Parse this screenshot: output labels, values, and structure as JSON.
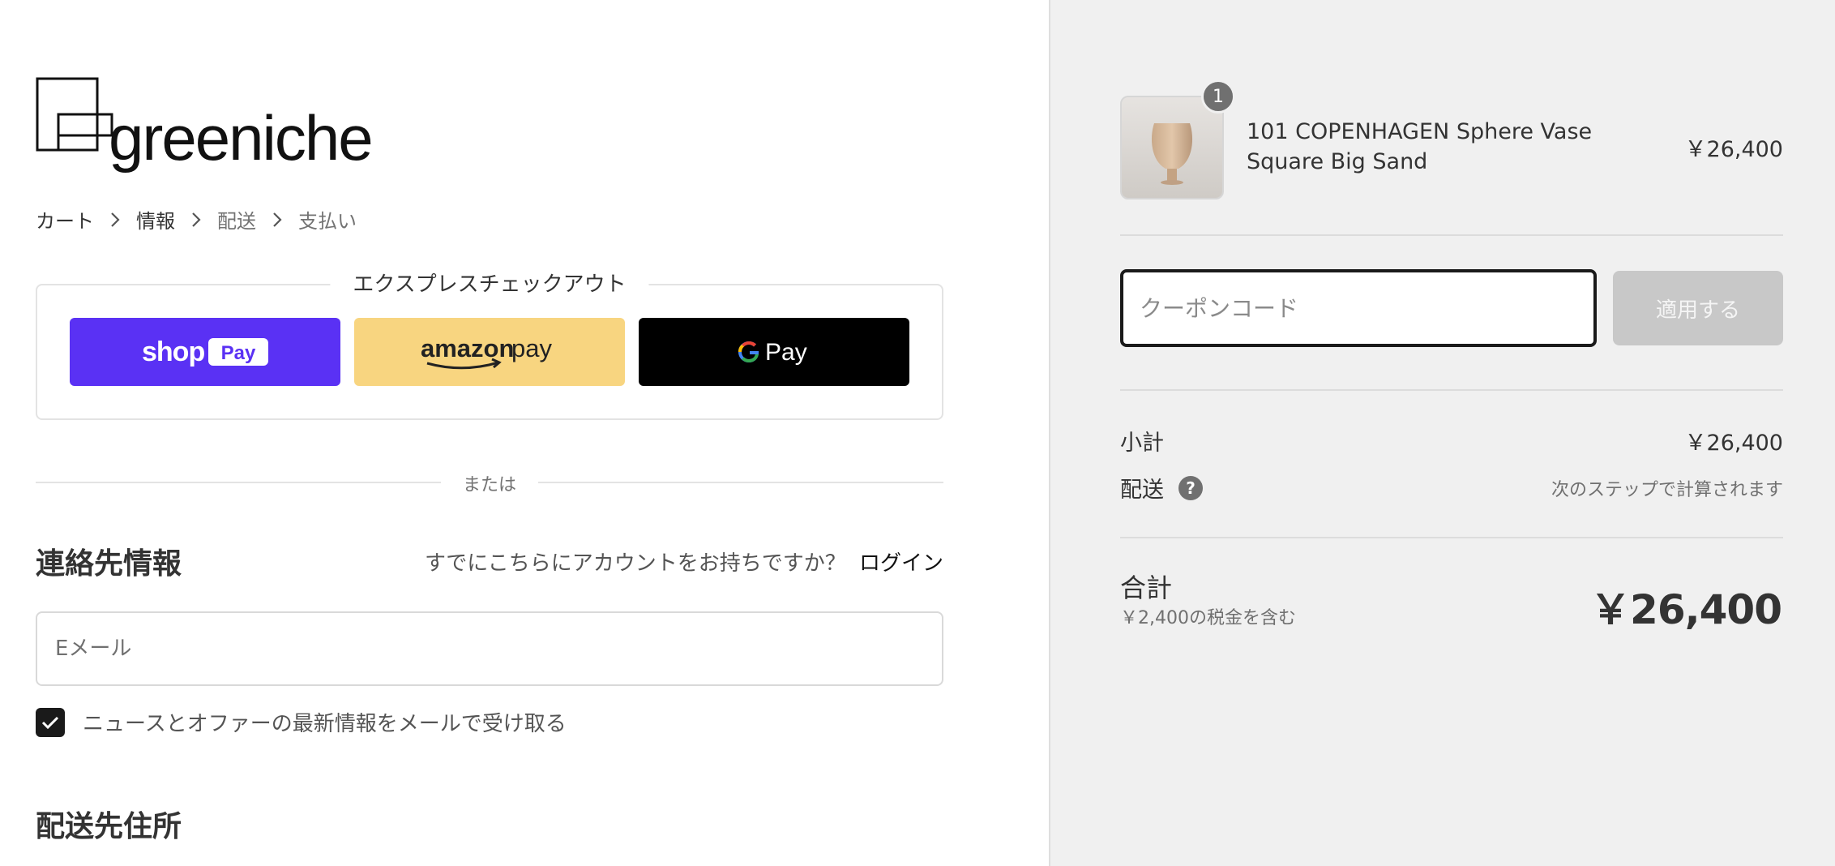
{
  "brand": {
    "name": "greeniche"
  },
  "breadcrumb": [
    {
      "label": "カート"
    },
    {
      "label": "情報"
    },
    {
      "label": "配送"
    },
    {
      "label": "支払い"
    }
  ],
  "express_checkout": {
    "title": "エクスプレスチェックアウト",
    "buttons": [
      {
        "name": "Shop Pay",
        "color": "#5a31f4"
      },
      {
        "name": "amazon pay",
        "color": "#f8d580"
      },
      {
        "name": "G Pay",
        "color": "#000000"
      }
    ]
  },
  "divider": {
    "or_label": "または"
  },
  "contact": {
    "title": "連絡先情報",
    "account_prompt": "すでにこちらにアカウントをお持ちですか？",
    "login_label": "ログイン",
    "email_placeholder": "Eメール",
    "newsletter_label": "ニュースとオファーの最新情報をメールで受け取る",
    "newsletter_checked": true
  },
  "shipping": {
    "title": "配送先住所"
  },
  "order": {
    "item": {
      "name": "101 COPENHAGEN Sphere Vase Square Big Sand",
      "price": "￥26,400",
      "quantity": "1"
    },
    "coupon_placeholder": "クーポンコード",
    "apply_label": "適用する",
    "subtotal_label": "小計",
    "subtotal_value": "￥26,400",
    "shipping_label": "配送",
    "shipping_value": "次のステップで計算されます",
    "total_label": "合計",
    "tax_note": "￥2,400の税金を含む",
    "total_value": "￥26,400"
  }
}
